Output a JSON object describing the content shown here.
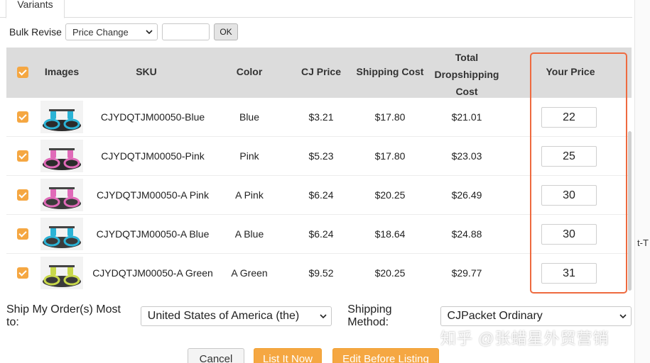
{
  "tabs": {
    "active": "Variants"
  },
  "bulk": {
    "label": "Bulk Revise",
    "select_value": "Price Change",
    "input_value": "",
    "ok_label": "OK"
  },
  "table": {
    "headers": {
      "images": "Images",
      "sku": "SKU",
      "color": "Color",
      "cj_price": "CJ Price",
      "shipping_cost": "Shipping Cost",
      "total_line1": "Total",
      "total_line2": "Dropshipping",
      "total_line3": "Cost",
      "your_price": "Your Price"
    },
    "rows": [
      {
        "sku": "CJYDQTJM00050-Blue",
        "color": "Blue",
        "cj_price": "$3.21",
        "shipping": "$17.80",
        "total": "$21.01",
        "your_price": "22",
        "ring": "#2bb3d6",
        "base": "#2b2b2b"
      },
      {
        "sku": "CJYDQTJM00050-Pink",
        "color": "Pink",
        "cj_price": "$5.23",
        "shipping": "$17.80",
        "total": "$23.03",
        "your_price": "25",
        "ring": "#e06ab8",
        "base": "#2b2b2b"
      },
      {
        "sku": "CJYDQTJM00050-A Pink",
        "color": "A Pink",
        "cj_price": "$6.24",
        "shipping": "$20.25",
        "total": "$26.49",
        "your_price": "30",
        "ring": "#e06ab8",
        "base": "#3a3a3a"
      },
      {
        "sku": "CJYDQTJM00050-A Blue",
        "color": "A Blue",
        "cj_price": "$6.24",
        "shipping": "$18.64",
        "total": "$24.88",
        "your_price": "30",
        "ring": "#2bb3d6",
        "base": "#3a3a3a"
      },
      {
        "sku": "CJYDQTJM00050-A Green",
        "color": "A Green",
        "cj_price": "$9.52",
        "shipping": "$20.25",
        "total": "$29.77",
        "your_price": "31",
        "ring": "#c8d84a",
        "base": "#3a3a3a"
      }
    ]
  },
  "shipping": {
    "to_label": "Ship My Order(s) Most to:",
    "to_value": "United States of America (the)",
    "method_label": "Shipping Method:",
    "method_value": "CJPacket Ordinary"
  },
  "buttons": {
    "cancel": "Cancel",
    "list_now": "List It Now",
    "edit_before": "Edit Before Listing"
  },
  "watermark": "知乎 @张蜡星外贸营销",
  "right_fragment": "t-T",
  "colors": {
    "accent": "#f5a742",
    "highlight": "#ee6a3f",
    "header_bg": "#dcdcdc"
  }
}
